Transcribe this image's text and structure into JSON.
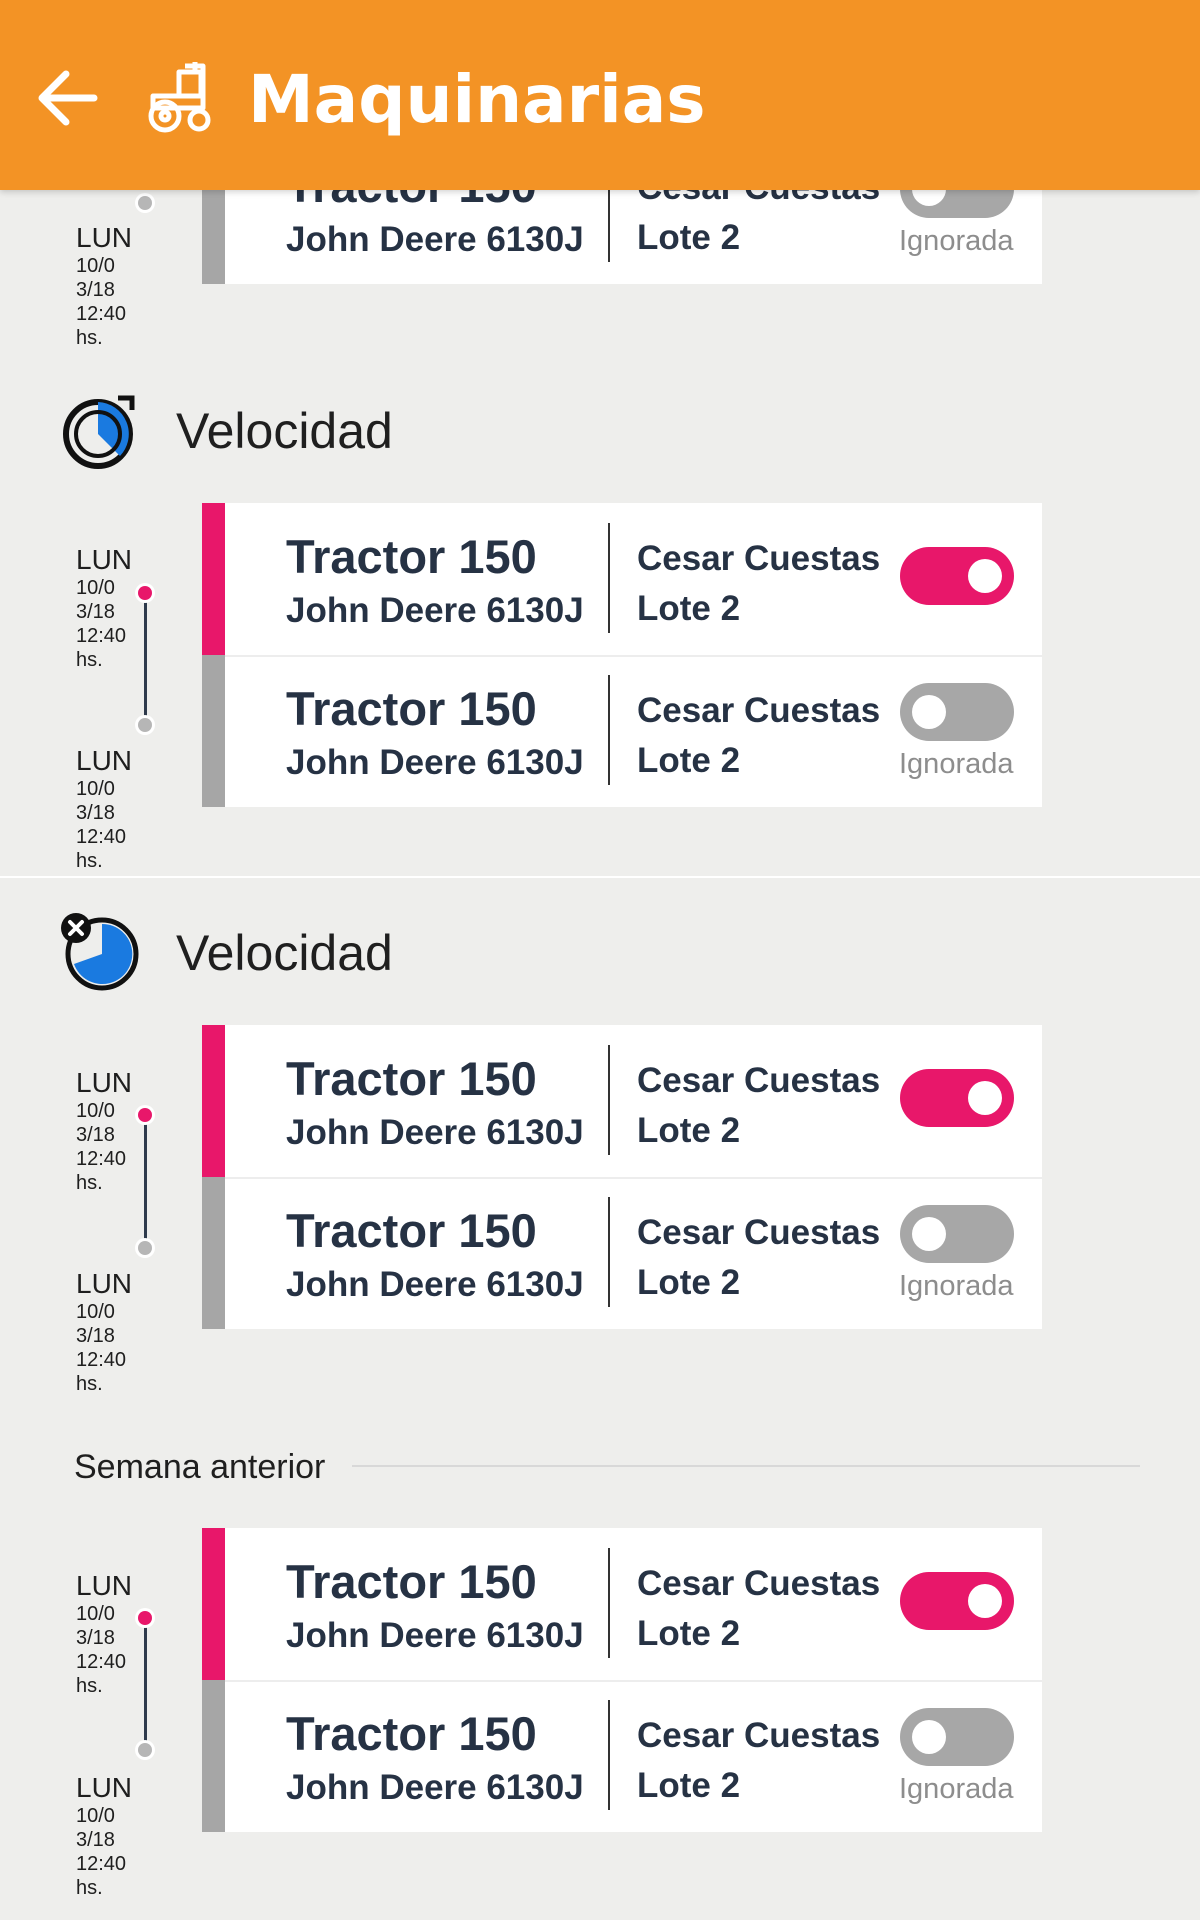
{
  "header": {
    "title": "Maquinarias",
    "back_icon": "arrow-left-icon",
    "app_icon": "tractor-icon",
    "background": "#f39325"
  },
  "colors": {
    "active": "#e8176a",
    "inactive": "#a6a6a6"
  },
  "timestamp": {
    "day": "LUN",
    "date_line1": "10/0",
    "date_line2": "3/18",
    "time": "12:40",
    "suffix": "hs."
  },
  "card": {
    "tractor": "Tractor 150",
    "model": "John Deere 6130J",
    "operator": "Cesar Cuestas",
    "lot": "Lote 2",
    "ignored_label": "Ignorada"
  },
  "sections": [
    {
      "title": "Velocidad",
      "icon": "speed-gauge-icon"
    },
    {
      "title": "Velocidad",
      "icon": "speed-gauge-cancelled-icon"
    }
  ],
  "week_label": "Semana anterior"
}
